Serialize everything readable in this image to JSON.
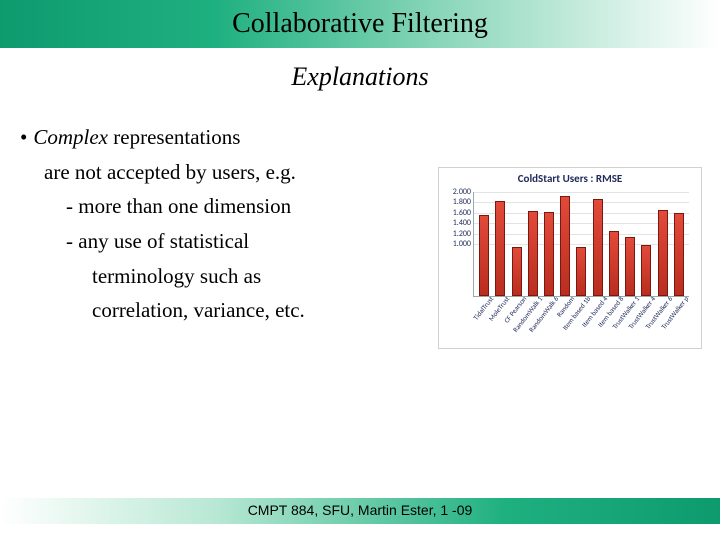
{
  "title": "Collaborative Filtering",
  "subtitle": "Explanations",
  "bullet": {
    "lead_em": "Complex",
    "lead_rest": " representations",
    "line2": "are not accepted by users, e.g.",
    "sub1": "- more than one dimension",
    "sub2": "- any use of statistical",
    "sub2b": "terminology such as",
    "sub2c": "correlation, variance, etc."
  },
  "footer": "CMPT 884, SFU, Martin Ester, 1 -09",
  "chart_data": {
    "type": "bar",
    "title": "ColdStart Users : RMSE",
    "ylabel": "",
    "xlabel": "",
    "ylim": [
      0,
      2.0
    ],
    "yticks": [
      "2.000",
      "1.800",
      "1.600",
      "1.400",
      "1.200",
      "1.000"
    ],
    "categories": [
      "TidalTrust",
      "MoleTrust",
      "CF Pearson",
      "RandomWalk 1",
      "RandomWalk 6",
      "Random",
      "Item based 1b",
      "Item based 4",
      "Item based 8",
      "TrustWalker 1",
      "TrustWalker 4",
      "TrustWalker 6",
      "TrustWalker p"
    ],
    "values": [
      1.51,
      1.79,
      0.9,
      1.6,
      1.57,
      1.88,
      0.9,
      1.82,
      1.22,
      1.1,
      0.95,
      1.62,
      1.55
    ]
  }
}
